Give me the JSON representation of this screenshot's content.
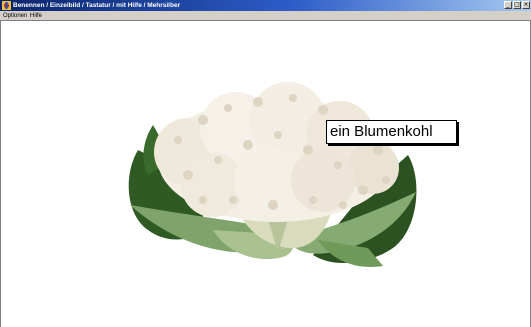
{
  "window": {
    "title": "Benennen / Einzelbild / Tastatur / mit Hilfe / Mehrsilber",
    "minimize_glyph": "_",
    "maximize_glyph": "□",
    "close_glyph": "×"
  },
  "menu": [
    {
      "label": "Optionen"
    },
    {
      "label": "Hilfe"
    }
  ],
  "content": {
    "caption": "ein Blumenkohl",
    "picture": {
      "icon": "cauliflower-image"
    }
  },
  "colors": {
    "titlebar_start": "#0a246a",
    "titlebar_end": "#a6caf0",
    "menubar": "#d4d0c8",
    "background": "#ffffff"
  }
}
